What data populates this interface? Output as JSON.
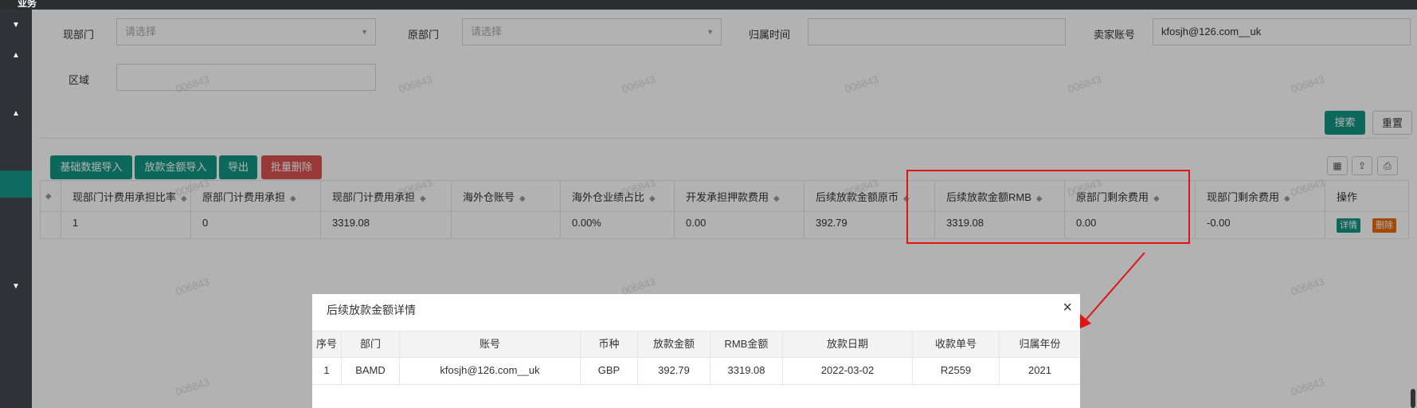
{
  "app": {
    "title": "业务"
  },
  "form": {
    "cur_dept_label": "现部门",
    "cur_dept_placeholder": "请选择",
    "orig_dept_label": "原部门",
    "orig_dept_placeholder": "请选择",
    "attr_time_label": "归属时间",
    "attr_time_value": "",
    "seller_label": "卖家账号",
    "seller_value": "kfosjh@126.com__uk",
    "region_label": "区域",
    "region_value": "",
    "search_label": "搜索",
    "reset_label": "重置"
  },
  "toolbar": {
    "import_base_label": "基础数据导入",
    "import_loan_label": "放款金额导入",
    "export_label": "导出",
    "batch_delete_label": "批量删除"
  },
  "table": {
    "headers": [
      "",
      "现部门计费用承担比率",
      "原部门计费用承担",
      "现部门计费用承担",
      "海外仓账号",
      "海外仓业绩占比",
      "开发承担押款费用",
      "后续放款金额原币",
      "后续放款金额RMB",
      "原部门剩余费用",
      "现部门剩余费用",
      "操作"
    ],
    "row": [
      "",
      "1",
      "0",
      "3319.08",
      "",
      "0.00%",
      "0.00",
      "392.79",
      "3319.08",
      "0.00",
      "-0.00"
    ],
    "detail_label": "详情",
    "delete_label": "删除"
  },
  "modal": {
    "title": "后续放款金额详情",
    "close": "×",
    "headers": [
      "序号",
      "部门",
      "账号",
      "币种",
      "放款金额",
      "RMB金额",
      "放款日期",
      "收款单号",
      "归属年份"
    ],
    "row": [
      "1",
      "BAMD",
      "kfosjh@126.com__uk",
      "GBP",
      "392.79",
      "3319.08",
      "2022-03-02",
      "R2559",
      "2021"
    ]
  },
  "watermark": "006843",
  "colors": {
    "primary": "#139585",
    "danger": "#d9534f",
    "highlight": "#e01414"
  }
}
